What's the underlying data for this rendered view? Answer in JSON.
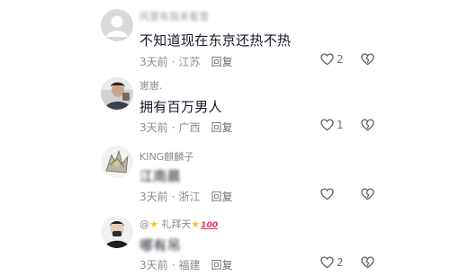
{
  "comments": [
    {
      "username": "风里有我来看雪",
      "text": "不知道现在东京还热不热",
      "time": "3天前",
      "location": "江苏",
      "reply_label": "回复",
      "likes": "2"
    },
    {
      "username": "崽崽.",
      "text": "拥有百万男人",
      "time": "3天前",
      "location": "广西",
      "reply_label": "回复",
      "likes": "1"
    },
    {
      "username": "KING麒麟子",
      "text": "江南晨",
      "time": "3天前",
      "location": "浙江",
      "reply_label": "回复",
      "likes": ""
    },
    {
      "username_prefix": "@",
      "username": "礼拜天",
      "text": "哪有吊",
      "time": "3天前",
      "location": "福建",
      "reply_label": "回复",
      "likes": "2"
    }
  ],
  "separator": "·",
  "icons": [
    "heart-outline-icon",
    "broken-heart-icon"
  ],
  "colors": {
    "text": "#161823",
    "meta": "#8a8b91",
    "star": "#f5c518"
  }
}
